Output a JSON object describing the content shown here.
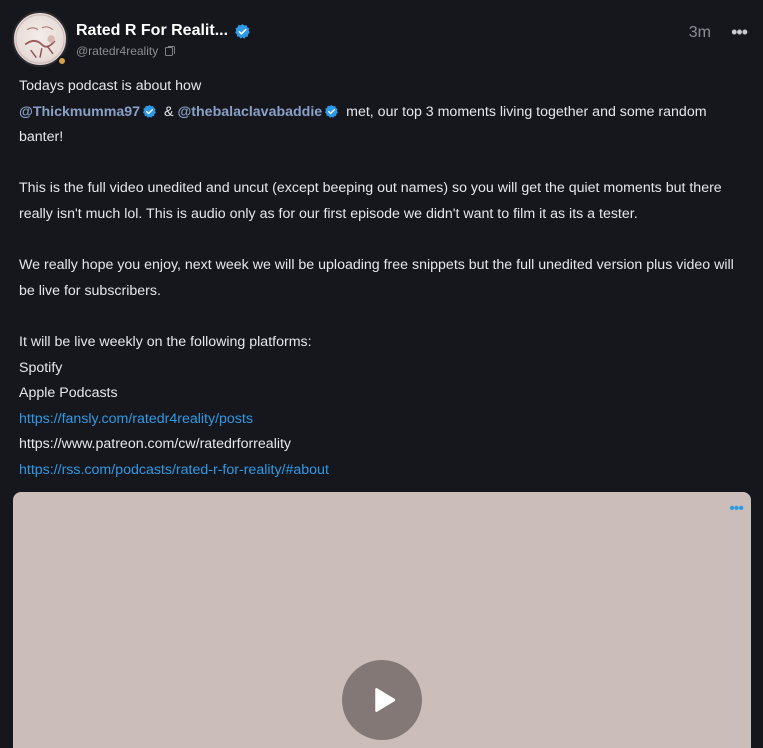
{
  "post": {
    "display_name": "Rated R For Realit...",
    "handle": "@ratedr4reality",
    "time": "3m",
    "more_label": "•••",
    "intro": "Todays podcast is about how",
    "mention_1": "@Thickmumma97",
    "amp": "&",
    "mention_2": "@thebalaclavabaddie",
    "intro_rest": "met, our top 3 moments living together and some random banter!",
    "para_2": "This is the full video unedited and uncut (except beeping out names) so you will get the quiet moments but there really isn't much lol. This is audio only as for our first episode we didn't want to film it as its a tester.",
    "para_3": "We really hope you enjoy, next week we will be uploading free snippets but the full unedited version plus video will be live for subscribers.",
    "para_4": "It will be live weekly on the following platforms:",
    "platform_1": "Spotify",
    "platform_2": "Apple Podcasts",
    "link_1": "https://fansly.com/ratedr4reality/posts",
    "link_2": "https://www.patreon.com/cw/ratedrforreality",
    "link_3": "https://rss.com/podcasts/rated-r-for-reality/#about"
  },
  "media": {
    "more_label": "•••"
  },
  "colors": {
    "background": "#16171c",
    "link": "#2e9ae6",
    "verified": "#2e9ae6",
    "media_bg": "#cbbdb9"
  },
  "icons": {
    "verified": "verified-badge-icon",
    "copy": "copy-icon",
    "play": "play-icon",
    "more": "more-dots-icon"
  }
}
